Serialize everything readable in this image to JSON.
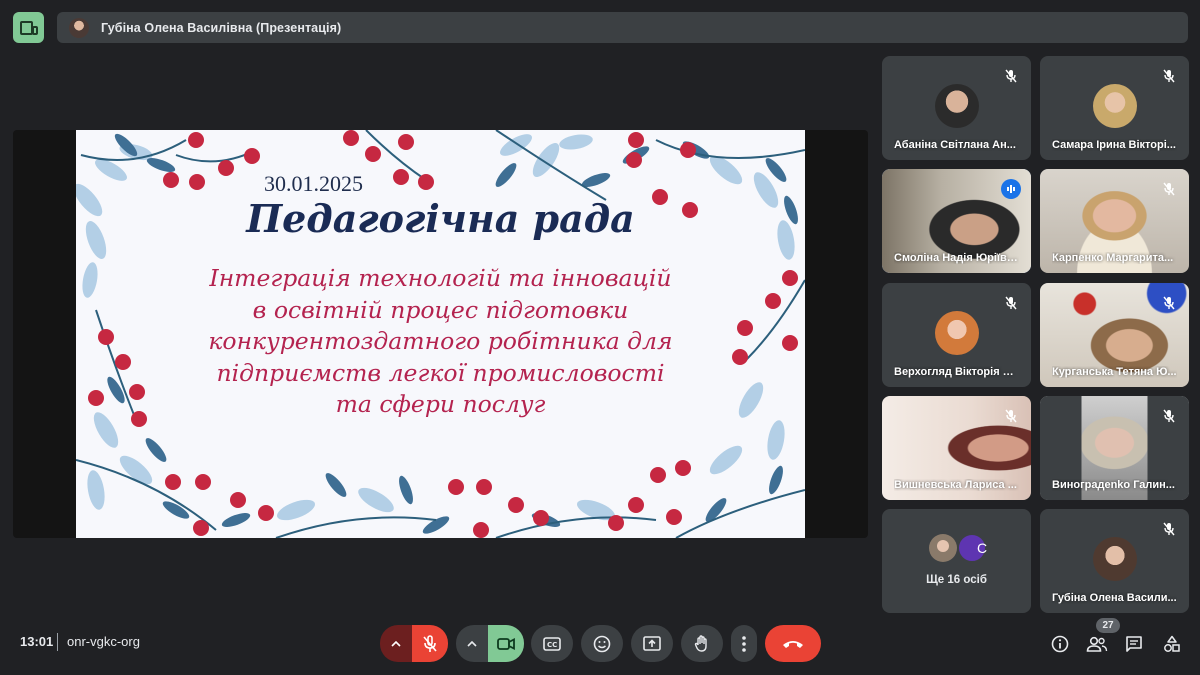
{
  "header": {
    "presenter_title": "Губіна Олена Василівна (Презентація)"
  },
  "slide": {
    "date": "30.01.2025",
    "heading": "Педагогічна рада",
    "subtitle_lines": [
      "Інтеграція технологій та інновацій",
      "в освітній процес підготовки",
      "конкурентоздатного робітника для",
      "підприємств легкої промисловості",
      "та сфери послуг"
    ]
  },
  "participants": [
    {
      "name": "Абаніна Світлана Ан...",
      "muted": true
    },
    {
      "name": "Самара Ірина Вікторі...",
      "muted": true
    },
    {
      "name": "Смоліна Надія Юріївна",
      "speaking": true
    },
    {
      "name": "Карпенко Маргарита...",
      "muted": true
    },
    {
      "name": "Верхогляд Вікторія О...",
      "muted": true
    },
    {
      "name": "Курганська Тетяна Ю...",
      "muted": true
    },
    {
      "name": "Вишневська Лариса ...",
      "muted": true
    },
    {
      "name": "Виноградenko Галин...",
      "muted": true
    },
    {
      "name": "Губіна Олена Васили...",
      "muted": true
    }
  ],
  "others": {
    "label": "Ще 16 осіб",
    "initial": "С"
  },
  "footer": {
    "time": "13:01",
    "meeting_code": "onr-vgkc-org",
    "participant_count": "27"
  },
  "colors": {
    "accent_green": "#81c995",
    "danger_red": "#ea4335",
    "active_blue": "#8ab4f8",
    "slide_heading": "#1a2b55",
    "slide_subtitle": "#b4234f"
  }
}
